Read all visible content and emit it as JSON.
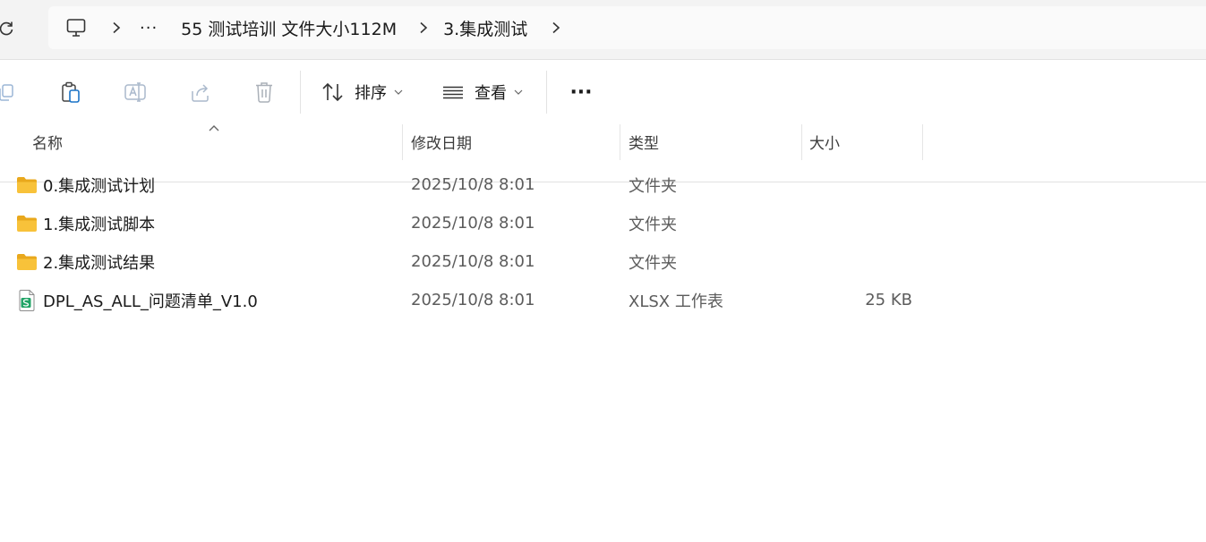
{
  "address_bar": {
    "more_crumb": "···",
    "crumbs": [
      "55 测试培训 文件大小112M",
      "3.集成测试"
    ]
  },
  "commands": {
    "sort_label": "排序",
    "view_label": "查看",
    "more_label": "···"
  },
  "columns": {
    "name": "名称",
    "modified": "修改日期",
    "type": "类型",
    "size": "大小"
  },
  "files": [
    {
      "name": "0.集成测试计划",
      "modified": "2025/10/8 8:01",
      "type": "文件夹",
      "size": "",
      "icon": "folder-icon"
    },
    {
      "name": "1.集成测试脚本",
      "modified": "2025/10/8 8:01",
      "type": "文件夹",
      "size": "",
      "icon": "folder-icon"
    },
    {
      "name": "2.集成测试结果",
      "modified": "2025/10/8 8:01",
      "type": "文件夹",
      "size": "",
      "icon": "folder-icon"
    },
    {
      "name": "DPL_AS_ALL_问题清单_V1.0",
      "modified": "2025/10/8 8:01",
      "type": "XLSX 工作表",
      "size": "25 KB",
      "icon": "xlsx-file-icon"
    }
  ],
  "colors": {
    "folder": "#f8c23a",
    "folder_dark": "#e9a81c",
    "xlsx": "#21a366"
  }
}
